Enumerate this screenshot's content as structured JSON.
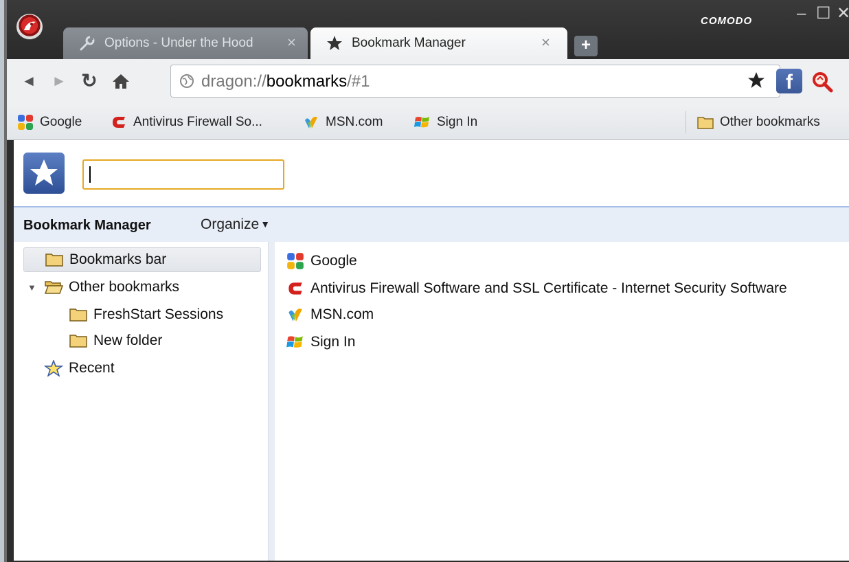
{
  "window": {
    "brand": "COMODO",
    "controls": {
      "minimize": "–",
      "maximize": "☐",
      "close": "✕"
    }
  },
  "tabs": [
    {
      "title": "Options - Under the Hood",
      "icon": "wrench-icon",
      "close": "×",
      "active": false
    },
    {
      "title": "Bookmark Manager",
      "icon": "star-icon",
      "close": "×",
      "active": true
    }
  ],
  "new_tab_label": "+",
  "toolbar": {
    "back": "◄",
    "forward": "►",
    "reload": "↻",
    "url_scheme": "dragon://",
    "url_host": "bookmarks",
    "url_rest": "/#1",
    "facebook_label": "f"
  },
  "bookmarks_bar": {
    "items": [
      {
        "label": "Google",
        "icon": "google-icon"
      },
      {
        "label": "Antivirus Firewall So...",
        "icon": "comodo-icon"
      },
      {
        "label": "MSN.com",
        "icon": "msn-icon"
      },
      {
        "label": "Sign In",
        "icon": "windows-icon"
      }
    ],
    "other_bookmarks": "Other bookmarks"
  },
  "manager": {
    "search_value": "",
    "title": "Bookmark Manager",
    "organize": "Organize",
    "tree": {
      "bookmarks_bar": "Bookmarks bar",
      "other_bookmarks": "Other bookmarks",
      "freshstart": "FreshStart Sessions",
      "new_folder": "New folder",
      "recent": "Recent"
    },
    "list": [
      {
        "label": "Google",
        "icon": "google-icon"
      },
      {
        "label": "Antivirus Firewall Software and SSL Certificate - Internet Security Software",
        "icon": "comodo-icon"
      },
      {
        "label": "MSN.com",
        "icon": "msn-icon"
      },
      {
        "label": "Sign In",
        "icon": "windows-icon"
      }
    ]
  },
  "colors": {
    "titlebar": "#2d2d2d",
    "toolbar": "#eef0f2",
    "search_focus": "#e5a824",
    "header_strip": "#e8eef8",
    "comodo_red": "#d3211d",
    "folder_yellow": "#f3d27a"
  }
}
